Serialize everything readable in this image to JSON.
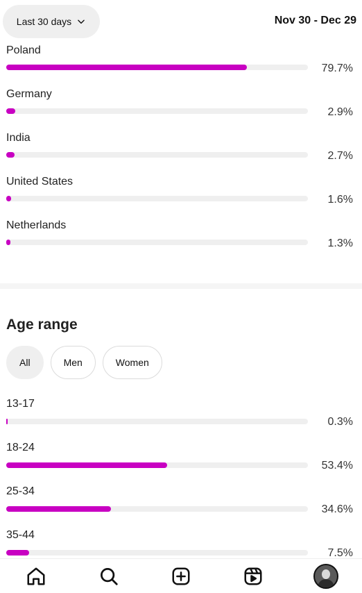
{
  "header": {
    "range_label": "Last 30 days",
    "date_range": "Nov 30 - Dec 29"
  },
  "countries": [
    {
      "label": "Poland",
      "value": "79.7%",
      "fraction": 0.797
    },
    {
      "label": "Germany",
      "value": "2.9%",
      "fraction": 0.029
    },
    {
      "label": "India",
      "value": "2.7%",
      "fraction": 0.027
    },
    {
      "label": "United States",
      "value": "1.6%",
      "fraction": 0.016
    },
    {
      "label": "Netherlands",
      "value": "1.3%",
      "fraction": 0.013
    }
  ],
  "age": {
    "title": "Age range",
    "filters": [
      "All",
      "Men",
      "Women"
    ],
    "selected_filter": "All",
    "rows": [
      {
        "label": "13-17",
        "value": "0.3%",
        "fraction": 0.003
      },
      {
        "label": "18-24",
        "value": "53.4%",
        "fraction": 0.534
      },
      {
        "label": "25-34",
        "value": "34.6%",
        "fraction": 0.346
      },
      {
        "label": "35-44",
        "value": "7.5%",
        "fraction": 0.075
      }
    ]
  },
  "nav": [
    "home-icon",
    "search-icon",
    "create-icon",
    "reels-icon",
    "profile-avatar"
  ],
  "colors": {
    "accent": "#c800c2",
    "track": "#efefef"
  }
}
